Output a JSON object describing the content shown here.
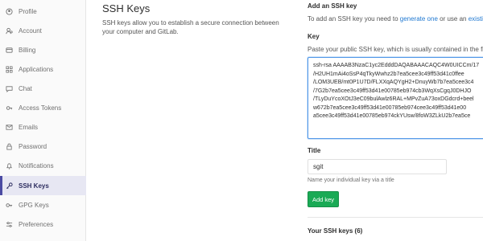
{
  "sidebar": {
    "items": [
      {
        "label": "Profile",
        "icon": "profile-icon",
        "active": false
      },
      {
        "label": "Account",
        "icon": "account-icon",
        "active": false
      },
      {
        "label": "Billing",
        "icon": "billing-icon",
        "active": false
      },
      {
        "label": "Applications",
        "icon": "applications-icon",
        "active": false
      },
      {
        "label": "Chat",
        "icon": "chat-icon",
        "active": false
      },
      {
        "label": "Access Tokens",
        "icon": "access-tokens-icon",
        "active": false
      },
      {
        "label": "Emails",
        "icon": "emails-icon",
        "active": false
      },
      {
        "label": "Password",
        "icon": "lock-icon",
        "active": false
      },
      {
        "label": "Notifications",
        "icon": "bell-icon",
        "active": false
      },
      {
        "label": "SSH Keys",
        "icon": "key-icon",
        "active": true
      },
      {
        "label": "GPG Keys",
        "icon": "gpg-key-icon",
        "active": false
      },
      {
        "label": "Preferences",
        "icon": "preferences-icon",
        "active": false
      }
    ]
  },
  "description": {
    "title": "SSH Keys",
    "text": "SSH keys allow you to establish a secure connection between your computer and GitLab."
  },
  "form": {
    "heading": "Add an SSH key",
    "intro_prefix": "To add an SSH key you need to ",
    "intro_link1": "generate one",
    "intro_middle": " or use an ",
    "intro_link2": "existing ke",
    "key_label": "Key",
    "key_help": "Paste your public SSH key, which is usually contained in the file '~/",
    "key_lines": [
      "ssh-rsa AAAAB3NzaC1yc2EdddDAQABAAACAQC4W0UICCm/17",
      "/H2UH1mAi4oSsP4qTkyWwhz2b7ea5cee3c49ff53d41c0ffee",
      "/LOM3UEB/mt0P1U7D/FLXXqAQYgH2+DnuyWb7b7ea5cee3c4",
      "/7G2b7ea5cee3c49ff53d41e00785eb974cb3WqXsCgqJ0DHJO",
      "/TLyDuYcoXOtJ3eC09bulAwlz6RAL+MPvZuA73oxDGdcrd+beel",
      "w672b7ea5cee3c49ff53d41e00785eb974cee3c49ff53d41e00",
      "a5cee3c49ff53d41e00785eb974ckYUsw/8foW3ZLkU2b7ea5ce"
    ],
    "title_label": "Title",
    "title_value": "sgit",
    "title_help": "Name your individual key via a title",
    "add_button": "Add key",
    "your_keys": "Your SSH keys (6)"
  },
  "colors": {
    "accent": "#4b4ba3",
    "button_green": "#1aaa55",
    "link_blue": "#1f78d1",
    "focus_blue": "#4f96e8"
  }
}
